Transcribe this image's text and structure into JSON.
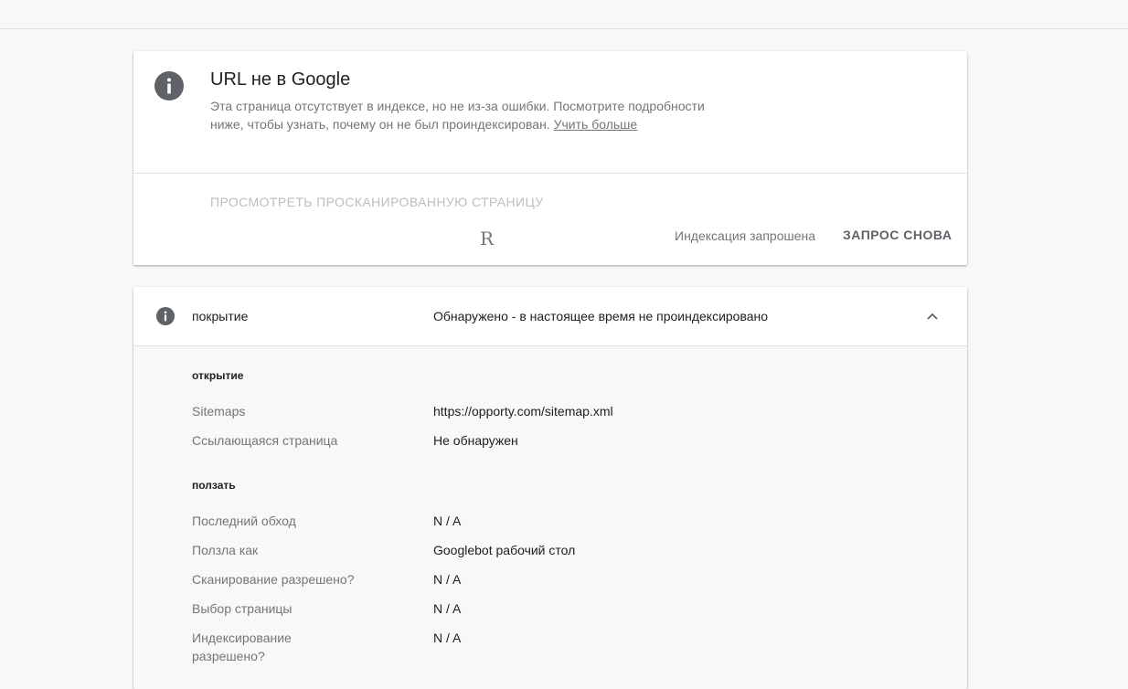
{
  "status": {
    "title": "URL не в Google",
    "description": "Эта страница отсутствует в индексе, но не из-за ошибки. Посмотрите подробности ниже, чтобы узнать, почему он не был проиндексирован.",
    "learn_more": "Учить больше",
    "view_crawled_label": "ПРОСМОТРЕТЬ ПРОСКАНИРОВАННУЮ СТРАНИЦУ",
    "glyph": "R",
    "indexing_status": "Индексация запрошена",
    "request_again_label": "ЗАПРОС СНОВА",
    "icon": "info-icon"
  },
  "coverage": {
    "label": "покрытие",
    "value": "Обнаружено - в настоящее время не проиндексировано",
    "icon": "info-icon",
    "chevron": "chevron-up-icon",
    "discovery": {
      "title": "открытие",
      "rows": [
        {
          "label": "Sitemaps",
          "value": "https://opporty.com/sitemap.xml"
        },
        {
          "label": "Ссылающаяся страница",
          "value": "Не обнаружен"
        }
      ]
    },
    "crawl": {
      "title": "ползать",
      "rows": [
        {
          "label": "Последний обход",
          "value": "N / A"
        },
        {
          "label": "Ползла как",
          "value": "Googlebot рабочий стол"
        },
        {
          "label": "Сканирование разрешено?",
          "value": "N / A"
        },
        {
          "label": "Выбор страницы",
          "value": "N / A"
        },
        {
          "label": "Индексирование разрешено?",
          "value": "N / A"
        }
      ]
    }
  },
  "colors": {
    "icon_grey": "#5f6368",
    "text_primary": "#202124",
    "text_secondary": "#757575",
    "disabled": "#bdbdbd"
  }
}
